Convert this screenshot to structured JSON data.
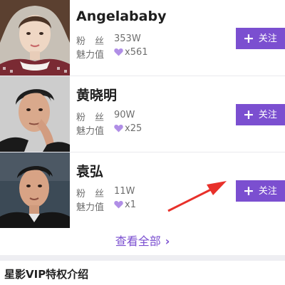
{
  "stars": [
    {
      "name": "Angelababy",
      "fans_label": "粉丝",
      "fans": "353W",
      "charm_label": "魅力值",
      "charm": "x561",
      "follow_label": "关注"
    },
    {
      "name": "黄晓明",
      "fans_label": "粉丝",
      "fans": "90W",
      "charm_label": "魅力值",
      "charm": "x25",
      "follow_label": "关注"
    },
    {
      "name": "袁弘",
      "fans_label": "粉丝",
      "fans": "11W",
      "charm_label": "魅力值",
      "charm": "x1",
      "follow_label": "关注"
    }
  ],
  "view_all_label": "查看全部",
  "section_title": "星影VIP特权介绍",
  "icons": {
    "heart": "heart-icon",
    "plus": "plus-icon",
    "chevron": "chevron-right-icon",
    "annotation": "red-arrow-annotation"
  },
  "colors": {
    "accent": "#7b4fd0",
    "heart": "#b08ee6",
    "annotation": "#e8302a"
  }
}
